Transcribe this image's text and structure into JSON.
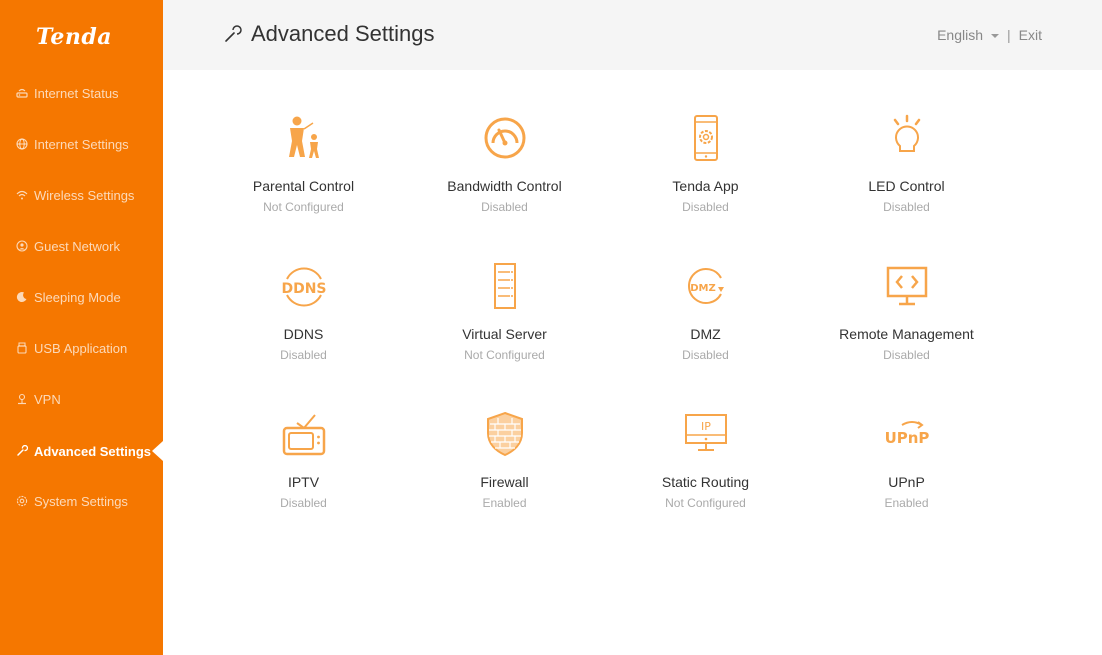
{
  "brand": {
    "logo_text": "Tenda",
    "accent_color": "#f57700"
  },
  "sidebar": {
    "items": [
      {
        "label": "Internet Status",
        "icon": "router-icon",
        "active": false
      },
      {
        "label": "Internet Settings",
        "icon": "globe-icon",
        "active": false
      },
      {
        "label": "Wireless Settings",
        "icon": "wifi-icon",
        "active": false
      },
      {
        "label": "Guest Network",
        "icon": "guest-icon",
        "active": false
      },
      {
        "label": "Sleeping Mode",
        "icon": "moon-icon",
        "active": false
      },
      {
        "label": "USB Application",
        "icon": "usb-icon",
        "active": false
      },
      {
        "label": "VPN",
        "icon": "vpn-icon",
        "active": false
      },
      {
        "label": "Advanced Settings",
        "icon": "wrench-icon",
        "active": true
      },
      {
        "label": "System Settings",
        "icon": "gear-icon",
        "active": false
      }
    ]
  },
  "header": {
    "title": "Advanced Settings",
    "title_icon": "wrench-icon",
    "language": "English",
    "separator": "|",
    "exit_label": "Exit"
  },
  "tiles": [
    {
      "name": "Parental Control",
      "status": "Not Configured",
      "icon": "parent-child-icon"
    },
    {
      "name": "Bandwidth Control",
      "status": "Disabled",
      "icon": "speedometer-icon"
    },
    {
      "name": "Tenda App",
      "status": "Disabled",
      "icon": "phone-gear-icon"
    },
    {
      "name": "LED Control",
      "status": "Disabled",
      "icon": "light-bulb-icon"
    },
    {
      "name": "DDNS",
      "status": "Disabled",
      "icon": "ddns-icon",
      "icon_text": "DDNS"
    },
    {
      "name": "Virtual Server",
      "status": "Not Configured",
      "icon": "server-rack-icon"
    },
    {
      "name": "DMZ",
      "status": "Disabled",
      "icon": "dmz-icon",
      "icon_text": "DMZ"
    },
    {
      "name": "Remote Management",
      "status": "Disabled",
      "icon": "monitor-code-icon"
    },
    {
      "name": "IPTV",
      "status": "Disabled",
      "icon": "tv-icon"
    },
    {
      "name": "Firewall",
      "status": "Enabled",
      "icon": "shield-brick-icon"
    },
    {
      "name": "Static Routing",
      "status": "Not Configured",
      "icon": "ip-monitor-icon",
      "icon_text": "IP"
    },
    {
      "name": "UPnP",
      "status": "Enabled",
      "icon": "upnp-icon",
      "icon_text": "UPnP"
    }
  ]
}
